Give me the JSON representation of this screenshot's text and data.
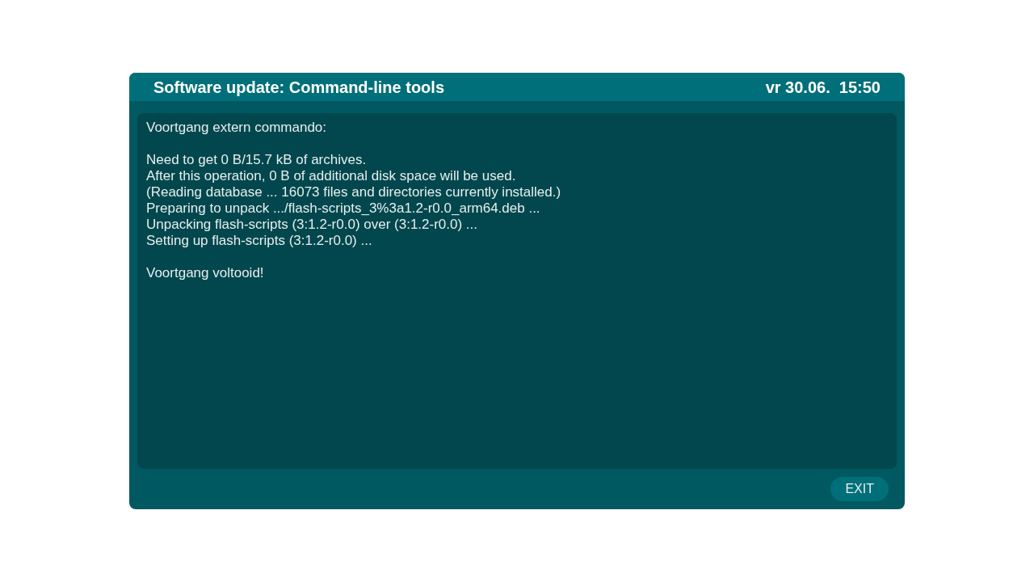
{
  "window": {
    "title": "Software update: Command-line tools",
    "clock": "vr 30.06.  15:50"
  },
  "log": {
    "heading": "Voortgang extern commando:",
    "lines": [
      "Need to get 0 B/15.7 kB of archives.",
      "After this operation, 0 B of additional disk space will be used.",
      "(Reading database ... 16073 files and directories currently installed.)",
      "Preparing to unpack .../flash-scripts_3%3a1.2-r0.0_arm64.deb ...",
      "Unpacking flash-scripts (3:1.2-r0.0) over (3:1.2-r0.0) ...",
      "Setting up flash-scripts (3:1.2-r0.0) ..."
    ],
    "footer": "Voortgang voltooid!"
  },
  "buttons": [
    {
      "label": "EXIT"
    }
  ]
}
